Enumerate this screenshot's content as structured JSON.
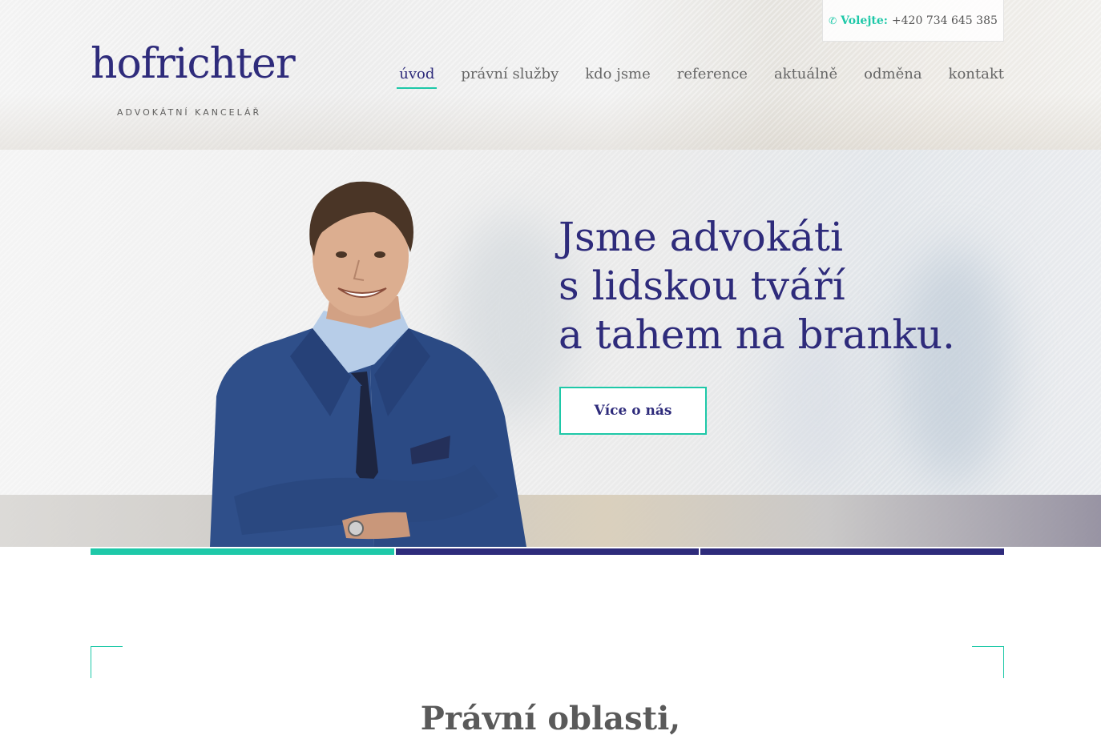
{
  "header": {
    "phone": {
      "icon": "phone-icon",
      "label": "Volejte:",
      "number": "+420 734 645 385"
    },
    "logo": {
      "name": "hofrichter",
      "subtitle": "ADVOKÁTNÍ KANCELÁŘ"
    },
    "nav": [
      {
        "label": "úvod",
        "active": true
      },
      {
        "label": "právní služby",
        "active": false
      },
      {
        "label": "kdo jsme",
        "active": false
      },
      {
        "label": "reference",
        "active": false
      },
      {
        "label": "aktuálně",
        "active": false
      },
      {
        "label": "odměna",
        "active": false
      },
      {
        "label": "kontakt",
        "active": false
      }
    ]
  },
  "hero": {
    "headline": [
      "Jsme advokáti",
      "s lidskou tváří",
      "a tahem na branku."
    ],
    "cta_label": "Více o nás"
  },
  "slider_bars": [
    {
      "color": "#1ec8a8",
      "active": true
    },
    {
      "color": "#2e2b7b",
      "active": false
    },
    {
      "color": "#2e2b7b",
      "active": false
    }
  ],
  "section": {
    "title": "Právní oblasti,"
  },
  "colors": {
    "brand": "#2e2b7b",
    "accent": "#1ec8a8"
  }
}
